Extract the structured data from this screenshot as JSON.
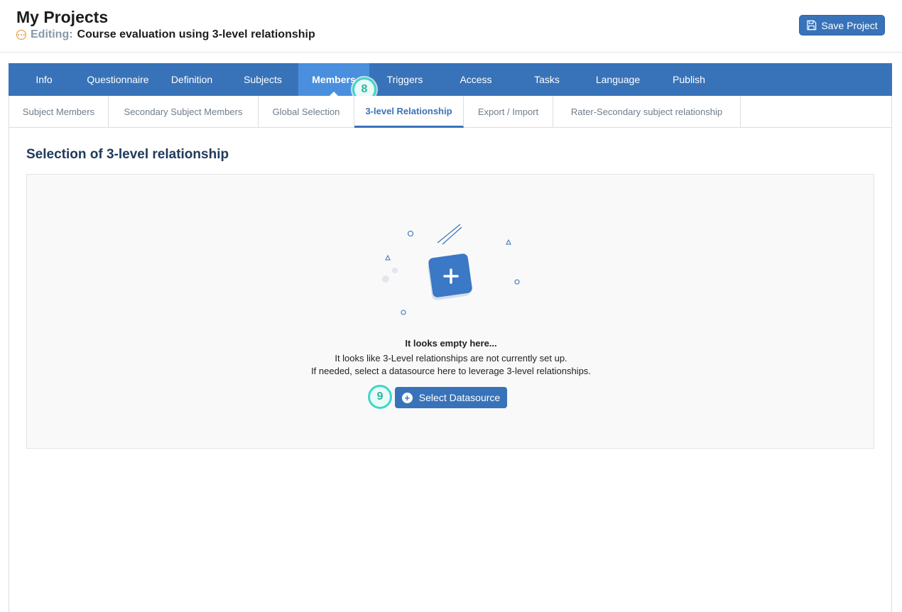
{
  "header": {
    "title": "My Projects",
    "editing_label": "Editing:",
    "project_name": "Course evaluation using 3-level relationship",
    "save_label": "Save Project"
  },
  "main_tabs": [
    {
      "label": "Info"
    },
    {
      "label": "Questionnaire"
    },
    {
      "label": "Definition"
    },
    {
      "label": "Subjects"
    },
    {
      "label": "Members",
      "active": true
    },
    {
      "label": "Triggers"
    },
    {
      "label": "Access"
    },
    {
      "label": "Tasks"
    },
    {
      "label": "Language"
    },
    {
      "label": "Publish"
    }
  ],
  "sub_tabs": [
    {
      "label": "Subject Members"
    },
    {
      "label": "Secondary Subject Members"
    },
    {
      "label": "Global Selection"
    },
    {
      "label": "3-level Relationship",
      "active": true
    },
    {
      "label": "Export / Import"
    },
    {
      "label": "Rater-Secondary subject relationship"
    }
  ],
  "badges": {
    "members": "8",
    "select": "9"
  },
  "content": {
    "section_title": "Selection of 3-level relationship",
    "empty_heading": "It looks empty here...",
    "empty_line1": "It looks like 3-Level relationships are not currently set up.",
    "empty_line2": "If needed, select a datasource here to leverage 3-level relationships.",
    "select_label": "Select Datasource"
  },
  "colors": {
    "primary": "#3873b9",
    "active_tab": "#4a8fdd",
    "badge": "#3fd6c6",
    "editing": "#e8902c"
  }
}
